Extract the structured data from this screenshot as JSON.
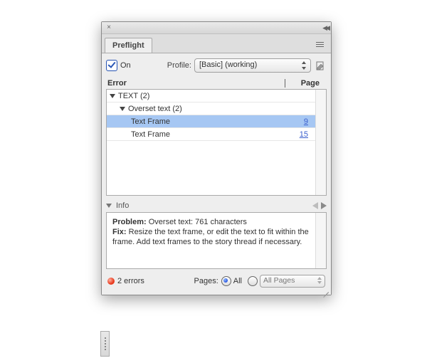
{
  "tab": {
    "title": "Preflight"
  },
  "options": {
    "on_label": "On",
    "on_checked": true,
    "profile_label": "Profile:",
    "profile_value": "[Basic] (working)"
  },
  "headers": {
    "error": "Error",
    "page": "Page"
  },
  "tree": {
    "group_label": "TEXT (2)",
    "subgroup_label": "Overset text (2)",
    "items": [
      {
        "label": "Text Frame",
        "page": "9",
        "selected": true
      },
      {
        "label": "Text Frame",
        "page": "15",
        "selected": false
      }
    ]
  },
  "info": {
    "header": "Info",
    "problem_label": "Problem:",
    "problem_text": "Overset text: 761 characters",
    "fix_label": "Fix:",
    "fix_text": "Resize the text frame, or edit the text to fit within the frame. Add text frames to the story thread if necessary."
  },
  "footer": {
    "status": "2 errors",
    "pages_label": "Pages:",
    "radio_all": "All",
    "range_value": "All Pages"
  }
}
